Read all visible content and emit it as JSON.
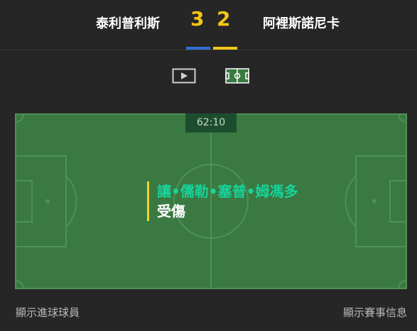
{
  "match": {
    "home_team": "泰利普利斯",
    "away_team": "阿裡斯諾尼卡",
    "home_score": "3",
    "away_score": "2",
    "home_color": "#2f6fd6",
    "away_color": "#f3c61a"
  },
  "views": [
    {
      "icon": "play-video-icon"
    },
    {
      "icon": "pitch-icon"
    }
  ],
  "pitch": {
    "clock": "62:10",
    "event_player": "讓•儒勒•塞普•姆馮多",
    "event_type": "受傷",
    "event_accent": "#f3d22a",
    "grass_color": "#3a7a42"
  },
  "footer": {
    "left_link": "顯示進球球員",
    "right_link": "顯示賽事信息"
  }
}
